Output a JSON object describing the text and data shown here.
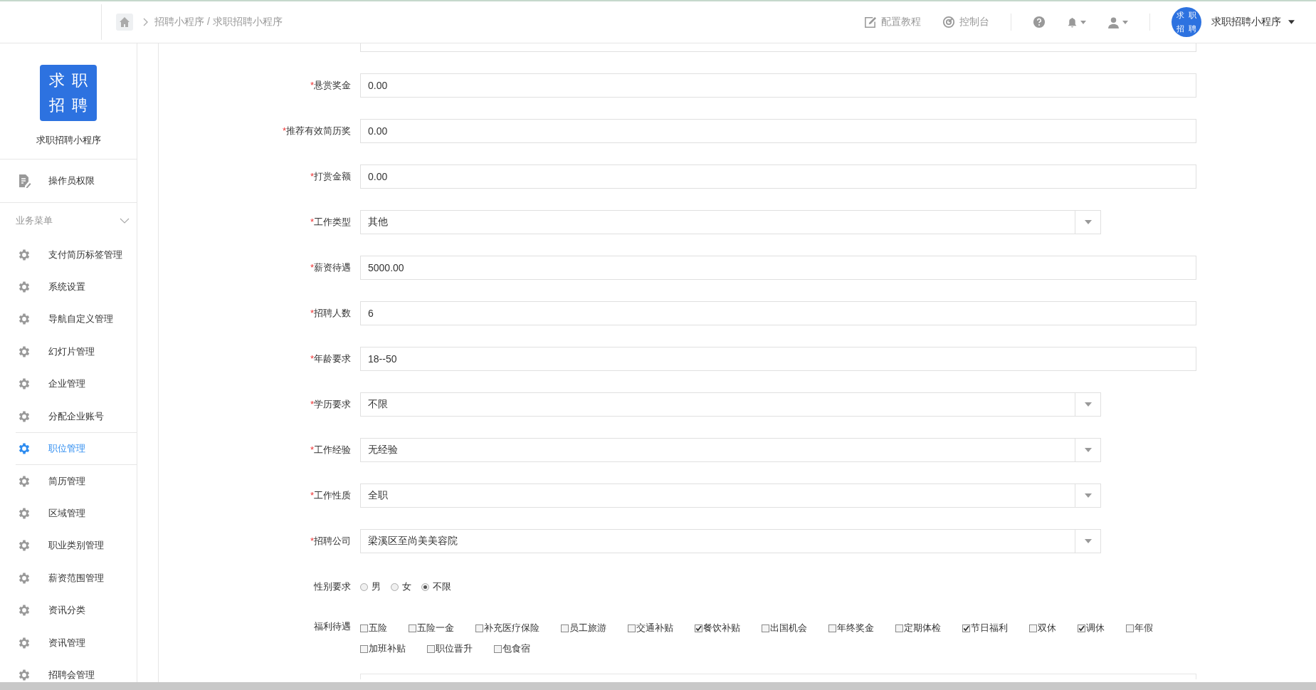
{
  "header": {
    "breadcrumb": [
      "招聘小程序",
      "求职招聘小程序"
    ],
    "breadcrumb_separator": "/",
    "links": [
      {
        "kind": "edit",
        "label": "配置教程"
      },
      {
        "kind": "dashboard",
        "label": "控制台"
      }
    ],
    "avatar_chars": [
      "求",
      "职",
      "招",
      "聘"
    ],
    "user_name": "求职招聘小程序"
  },
  "sidebar": {
    "logo_chars": [
      "求",
      "职",
      "招",
      "聘"
    ],
    "app_name": "求职招聘小程序",
    "top_item": "操作员权限",
    "section": {
      "title": "业务菜单",
      "expanded": true
    },
    "items": [
      {
        "label": "支付简历标签管理",
        "selected": false
      },
      {
        "label": "系统设置",
        "selected": false
      },
      {
        "label": "导航自定义管理",
        "selected": false
      },
      {
        "label": "幻灯片管理",
        "selected": false
      },
      {
        "label": "企业管理",
        "selected": false
      },
      {
        "label": "分配企业账号",
        "selected": false
      },
      {
        "label": "职位管理",
        "selected": true
      },
      {
        "label": "简历管理",
        "selected": false
      },
      {
        "label": "区域管理",
        "selected": false
      },
      {
        "label": "职业类别管理",
        "selected": false
      },
      {
        "label": "薪资范围管理",
        "selected": false
      },
      {
        "label": "资讯分类",
        "selected": false
      },
      {
        "label": "资讯管理",
        "selected": false
      },
      {
        "label": "招聘会管理",
        "selected": false
      }
    ]
  },
  "form": {
    "fields": [
      {
        "kind": "text",
        "label": "悬赏奖金",
        "required": true,
        "value": "0.00"
      },
      {
        "kind": "text",
        "label": "推荐有效简历奖",
        "required": true,
        "value": "0.00"
      },
      {
        "kind": "text",
        "label": "打赏金额",
        "required": true,
        "value": "0.00"
      },
      {
        "kind": "select",
        "label": "工作类型",
        "required": true,
        "value": "其他"
      },
      {
        "kind": "text",
        "label": "薪资待遇",
        "required": true,
        "value": "5000.00"
      },
      {
        "kind": "text",
        "label": "招聘人数",
        "required": true,
        "value": "6"
      },
      {
        "kind": "text",
        "label": "年龄要求",
        "required": true,
        "value": "18--50"
      },
      {
        "kind": "select",
        "label": "学历要求",
        "required": true,
        "value": "不限"
      },
      {
        "kind": "select",
        "label": "工作经验",
        "required": true,
        "value": "无经验"
      },
      {
        "kind": "select",
        "label": "工作性质",
        "required": true,
        "value": "全职"
      },
      {
        "kind": "select",
        "label": "招聘公司",
        "required": true,
        "value": "梁溪区至尚美美容院"
      }
    ],
    "required_mark": "*",
    "gender": {
      "label": "性别要求",
      "options": [
        {
          "label": "男",
          "selected": false
        },
        {
          "label": "女",
          "selected": false
        },
        {
          "label": "不限",
          "selected": true
        }
      ]
    },
    "benefits": {
      "label": "福利待遇",
      "options": [
        {
          "label": "五险",
          "checked": false
        },
        {
          "label": "五险一金",
          "checked": false
        },
        {
          "label": "补充医疗保险",
          "checked": false
        },
        {
          "label": "员工旅游",
          "checked": false
        },
        {
          "label": "交通补贴",
          "checked": false
        },
        {
          "label": "餐饮补贴",
          "checked": true
        },
        {
          "label": "出国机会",
          "checked": false
        },
        {
          "label": "年终奖金",
          "checked": false
        },
        {
          "label": "定期体检",
          "checked": false
        },
        {
          "label": "节日福利",
          "checked": true
        },
        {
          "label": "双休",
          "checked": false
        },
        {
          "label": "调休",
          "checked": true
        },
        {
          "label": "年假",
          "checked": false
        },
        {
          "label": "加班补贴",
          "checked": false
        },
        {
          "label": "职位晋升",
          "checked": false
        },
        {
          "label": "包食宿",
          "checked": false
        }
      ]
    }
  }
}
